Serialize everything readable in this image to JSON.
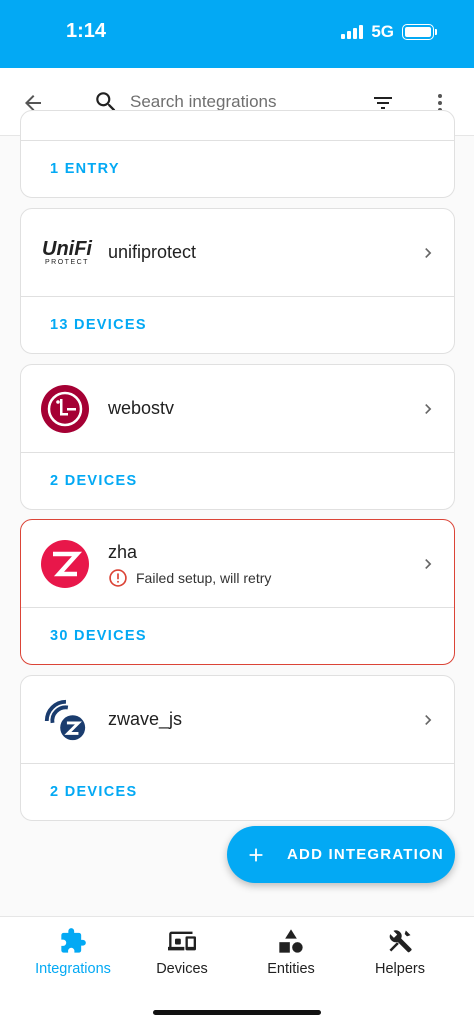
{
  "status_bar": {
    "time": "1:14",
    "network": "5G"
  },
  "header": {
    "search_placeholder": "Search integrations"
  },
  "integrations": [
    {
      "title": "",
      "footer": "1 ENTRY"
    },
    {
      "title": "unifiprotect",
      "footer": "13 DEVICES",
      "logo_text": "UniFi",
      "logo_subtext": "PROTECT"
    },
    {
      "title": "webostv",
      "footer": "2 DEVICES",
      "logo_text": "LG"
    },
    {
      "title": "zha",
      "footer": "30 DEVICES",
      "status": "Failed setup, will retry"
    },
    {
      "title": "zwave_js",
      "footer": "2 DEVICES"
    }
  ],
  "fab": {
    "label": "ADD INTEGRATION"
  },
  "bottom_nav": [
    {
      "label": "Integrations"
    },
    {
      "label": "Devices"
    },
    {
      "label": "Entities"
    },
    {
      "label": "Helpers"
    }
  ],
  "colors": {
    "accent": "#03a9f4",
    "error": "#db4437",
    "lg": "#a50034",
    "zha": "#e8174a",
    "zwave": "#1a3c6e"
  }
}
